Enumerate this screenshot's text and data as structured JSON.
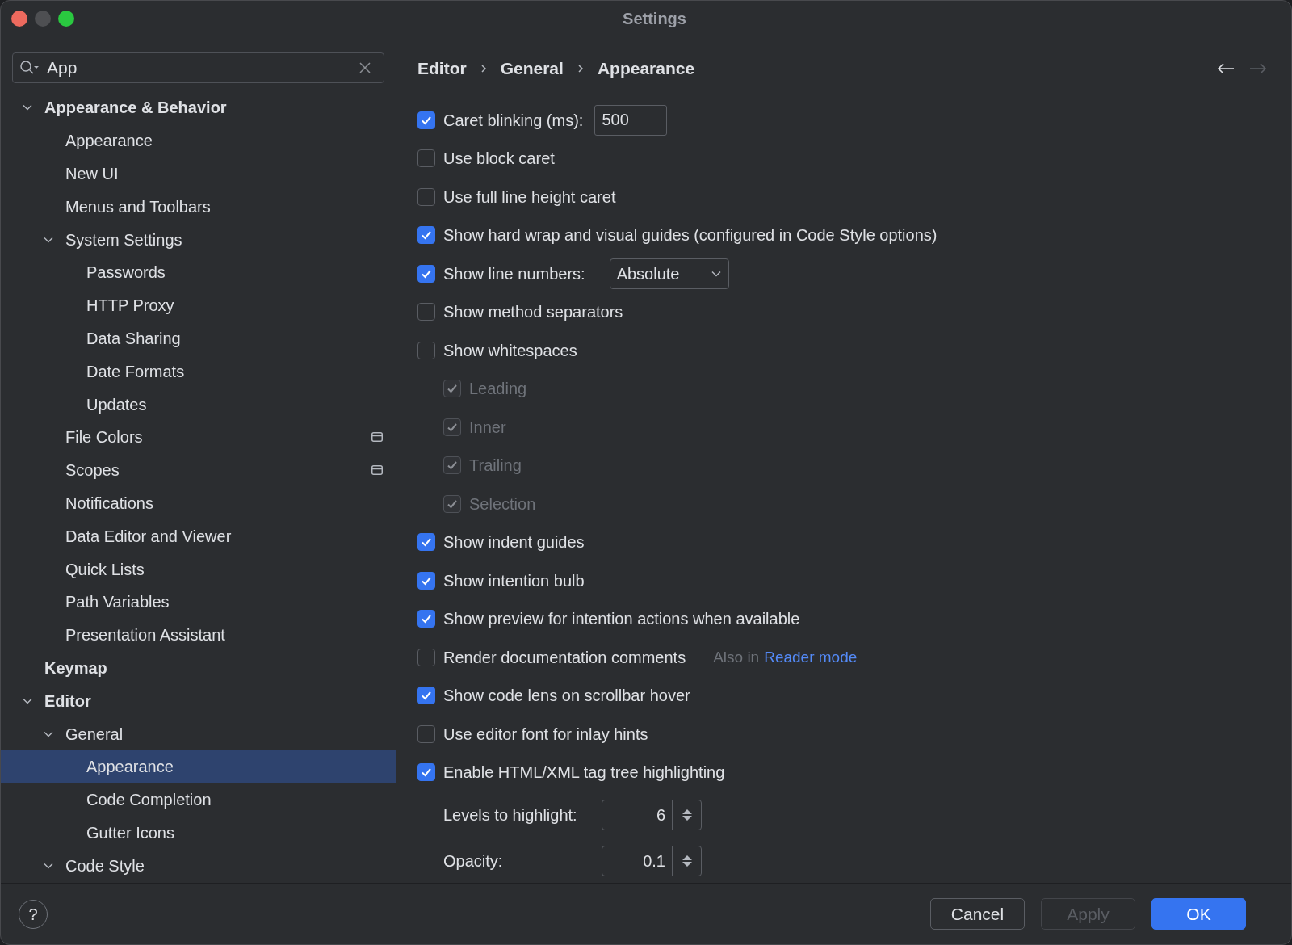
{
  "window": {
    "title": "Settings"
  },
  "search": {
    "value": "App"
  },
  "tree": [
    {
      "label": "Appearance & Behavior",
      "selected": false,
      "expanded": true,
      "children": [
        {
          "label": "Appearance",
          "selected": false
        },
        {
          "label": "New UI",
          "selected": false
        },
        {
          "label": "Menus and Toolbars",
          "selected": false
        },
        {
          "label": "System Settings",
          "selected": false,
          "expanded": true,
          "children": [
            {
              "label": "Passwords",
              "selected": false
            },
            {
              "label": "HTTP Proxy",
              "selected": false
            },
            {
              "label": "Data Sharing",
              "selected": false
            },
            {
              "label": "Date Formats",
              "selected": false
            },
            {
              "label": "Updates",
              "selected": false
            }
          ]
        },
        {
          "label": "File Colors",
          "selected": false,
          "badge": true
        },
        {
          "label": "Scopes",
          "selected": false,
          "badge": true
        },
        {
          "label": "Notifications",
          "selected": false
        },
        {
          "label": "Data Editor and Viewer",
          "selected": false
        },
        {
          "label": "Quick Lists",
          "selected": false
        },
        {
          "label": "Path Variables",
          "selected": false
        },
        {
          "label": "Presentation Assistant",
          "selected": false
        }
      ]
    },
    {
      "label": "Keymap",
      "selected": false
    },
    {
      "label": "Editor",
      "selected": false,
      "expanded": true,
      "children": [
        {
          "label": "General",
          "selected": false,
          "expanded": true,
          "children": [
            {
              "label": "Appearance",
              "selected": true
            },
            {
              "label": "Code Completion",
              "selected": false
            },
            {
              "label": "Gutter Icons",
              "selected": false
            }
          ]
        },
        {
          "label": "Code Style",
          "selected": false,
          "expanded": true
        }
      ]
    }
  ],
  "breadcrumb": [
    "Editor",
    "General",
    "Appearance"
  ],
  "nav": {
    "back_disabled": false,
    "forward_disabled": true
  },
  "options": [
    {
      "kind": "checkbox",
      "label": "Caret blinking (ms):",
      "checked": true,
      "field": "500"
    },
    {
      "kind": "checkbox",
      "label": "Use block caret",
      "checked": false
    },
    {
      "kind": "checkbox",
      "label": "Use full line height caret",
      "checked": false
    },
    {
      "kind": "checkbox",
      "label": "Show hard wrap and visual guides (configured in Code Style options)",
      "checked": true
    },
    {
      "kind": "checkbox",
      "label": "Show line numbers:",
      "checked": true,
      "dropdown": "Absolute"
    },
    {
      "kind": "checkbox",
      "label": "Show method separators",
      "checked": false
    },
    {
      "kind": "checkbox",
      "label": "Show whitespaces",
      "checked": false
    },
    {
      "kind": "subcheckbox",
      "label": "Leading",
      "checked": true,
      "disabled": true
    },
    {
      "kind": "subcheckbox",
      "label": "Inner",
      "checked": true,
      "disabled": true
    },
    {
      "kind": "subcheckbox",
      "label": "Trailing",
      "checked": true,
      "disabled": true
    },
    {
      "kind": "subcheckbox",
      "label": "Selection",
      "checked": true,
      "disabled": true
    },
    {
      "kind": "checkbox",
      "label": "Show indent guides",
      "checked": true
    },
    {
      "kind": "checkbox",
      "label": "Show intention bulb",
      "checked": true
    },
    {
      "kind": "checkbox",
      "label": "Show preview for intention actions when available",
      "checked": true
    },
    {
      "kind": "checkbox",
      "label": "Render documentation comments",
      "checked": false,
      "note": "Also in",
      "link": "Reader mode"
    },
    {
      "kind": "checkbox",
      "label": "Show code lens on scrollbar hover",
      "checked": true
    },
    {
      "kind": "checkbox",
      "label": "Use editor font for inlay hints",
      "checked": false
    },
    {
      "kind": "checkbox",
      "label": "Enable HTML/XML tag tree highlighting",
      "checked": true
    },
    {
      "kind": "spinner",
      "label": "Levels to highlight:",
      "value": "6"
    },
    {
      "kind": "spinner",
      "label": "Opacity:",
      "value": "0.1"
    }
  ],
  "footer": {
    "help": "?",
    "buttons": [
      {
        "label": "Cancel",
        "kind": "secondary",
        "disabled": false
      },
      {
        "label": "Apply",
        "kind": "secondary",
        "disabled": true
      },
      {
        "label": "OK",
        "kind": "primary",
        "disabled": false
      }
    ]
  }
}
